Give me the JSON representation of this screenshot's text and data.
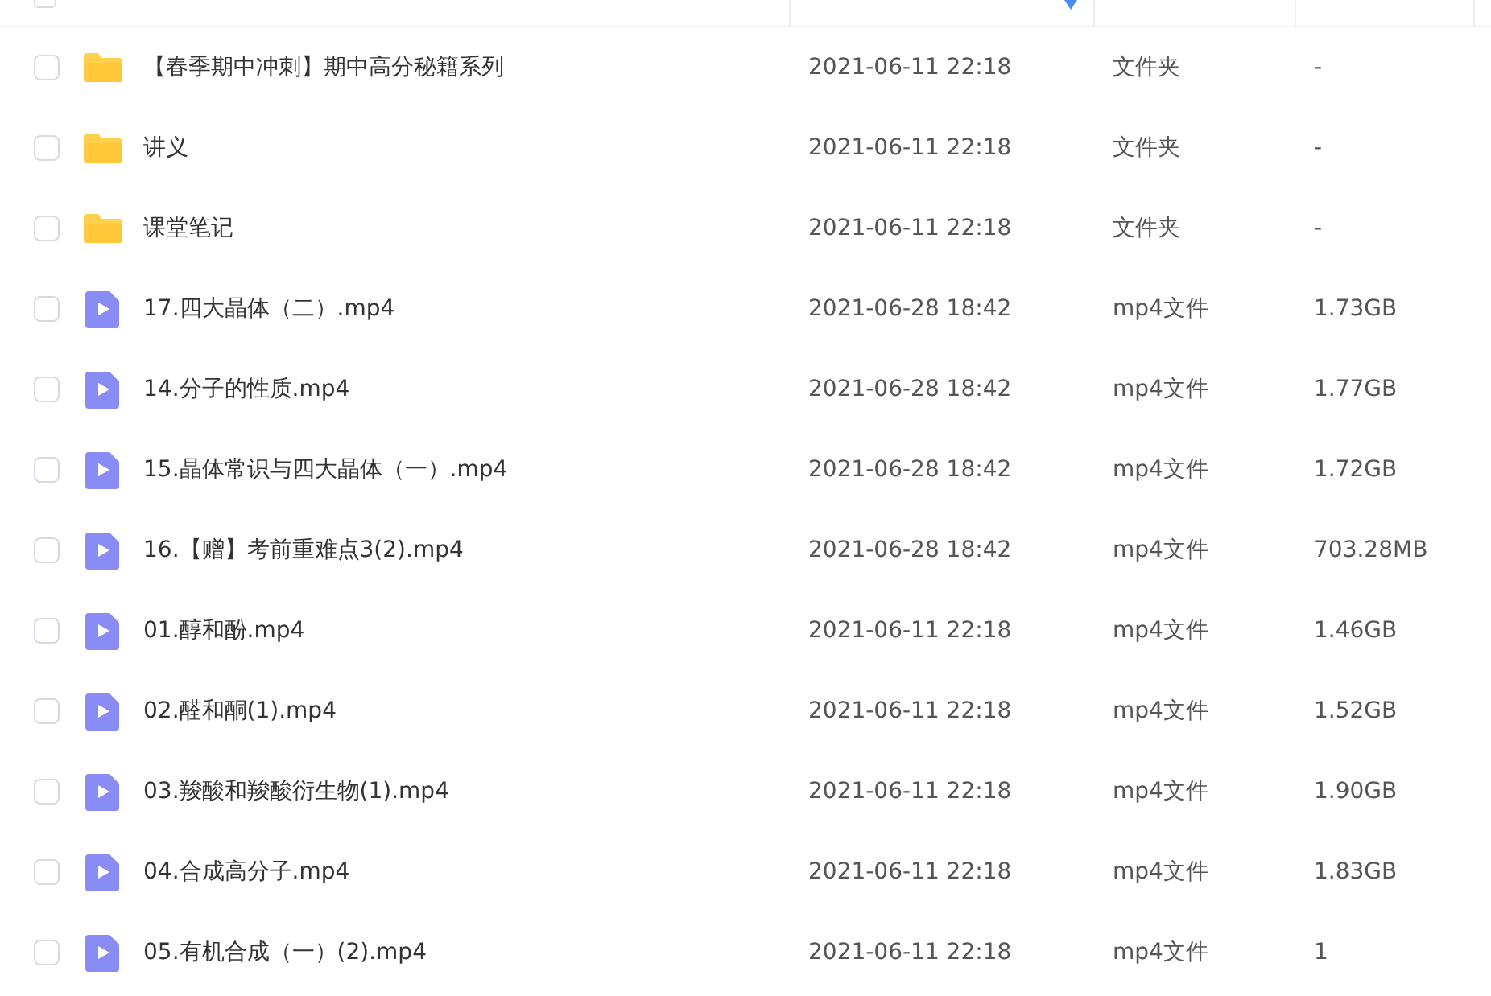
{
  "select_all": {
    "checked": false
  },
  "files": [
    {
      "kind": "folder",
      "name": "【春季期中冲刺】期中高分秘籍系列",
      "modified": "2021-06-11 22:18",
      "type": "文件夹",
      "size": "-",
      "checked": false
    },
    {
      "kind": "folder",
      "name": "讲义",
      "modified": "2021-06-11 22:18",
      "type": "文件夹",
      "size": "-",
      "checked": false
    },
    {
      "kind": "folder",
      "name": "课堂笔记",
      "modified": "2021-06-11 22:18",
      "type": "文件夹",
      "size": "-",
      "checked": false
    },
    {
      "kind": "video",
      "name": "17.四大晶体（二）.mp4",
      "modified": "2021-06-28 18:42",
      "type": "mp4文件",
      "size": "1.73GB",
      "checked": false
    },
    {
      "kind": "video",
      "name": "14.分子的性质.mp4",
      "modified": "2021-06-28 18:42",
      "type": "mp4文件",
      "size": "1.77GB",
      "checked": false
    },
    {
      "kind": "video",
      "name": "15.晶体常识与四大晶体（一）.mp4",
      "modified": "2021-06-28 18:42",
      "type": "mp4文件",
      "size": "1.72GB",
      "checked": false
    },
    {
      "kind": "video",
      "name": "16.【赠】考前重难点3(2).mp4",
      "modified": "2021-06-28 18:42",
      "type": "mp4文件",
      "size": "703.28MB",
      "checked": false
    },
    {
      "kind": "video",
      "name": "01.醇和酚.mp4",
      "modified": "2021-06-11 22:18",
      "type": "mp4文件",
      "size": "1.46GB",
      "checked": false
    },
    {
      "kind": "video",
      "name": "02.醛和酮(1).mp4",
      "modified": "2021-06-11 22:18",
      "type": "mp4文件",
      "size": "1.52GB",
      "checked": false
    },
    {
      "kind": "video",
      "name": "03.羧酸和羧酸衍生物(1).mp4",
      "modified": "2021-06-11 22:18",
      "type": "mp4文件",
      "size": "1.90GB",
      "checked": false
    },
    {
      "kind": "video",
      "name": "04.合成高分子.mp4",
      "modified": "2021-06-11 22:18",
      "type": "mp4文件",
      "size": "1.83GB",
      "checked": false
    },
    {
      "kind": "video",
      "name": "05.有机合成（一）(2).mp4",
      "modified": "2021-06-11 22:18",
      "type": "mp4文件",
      "size": "1",
      "checked": false
    }
  ]
}
